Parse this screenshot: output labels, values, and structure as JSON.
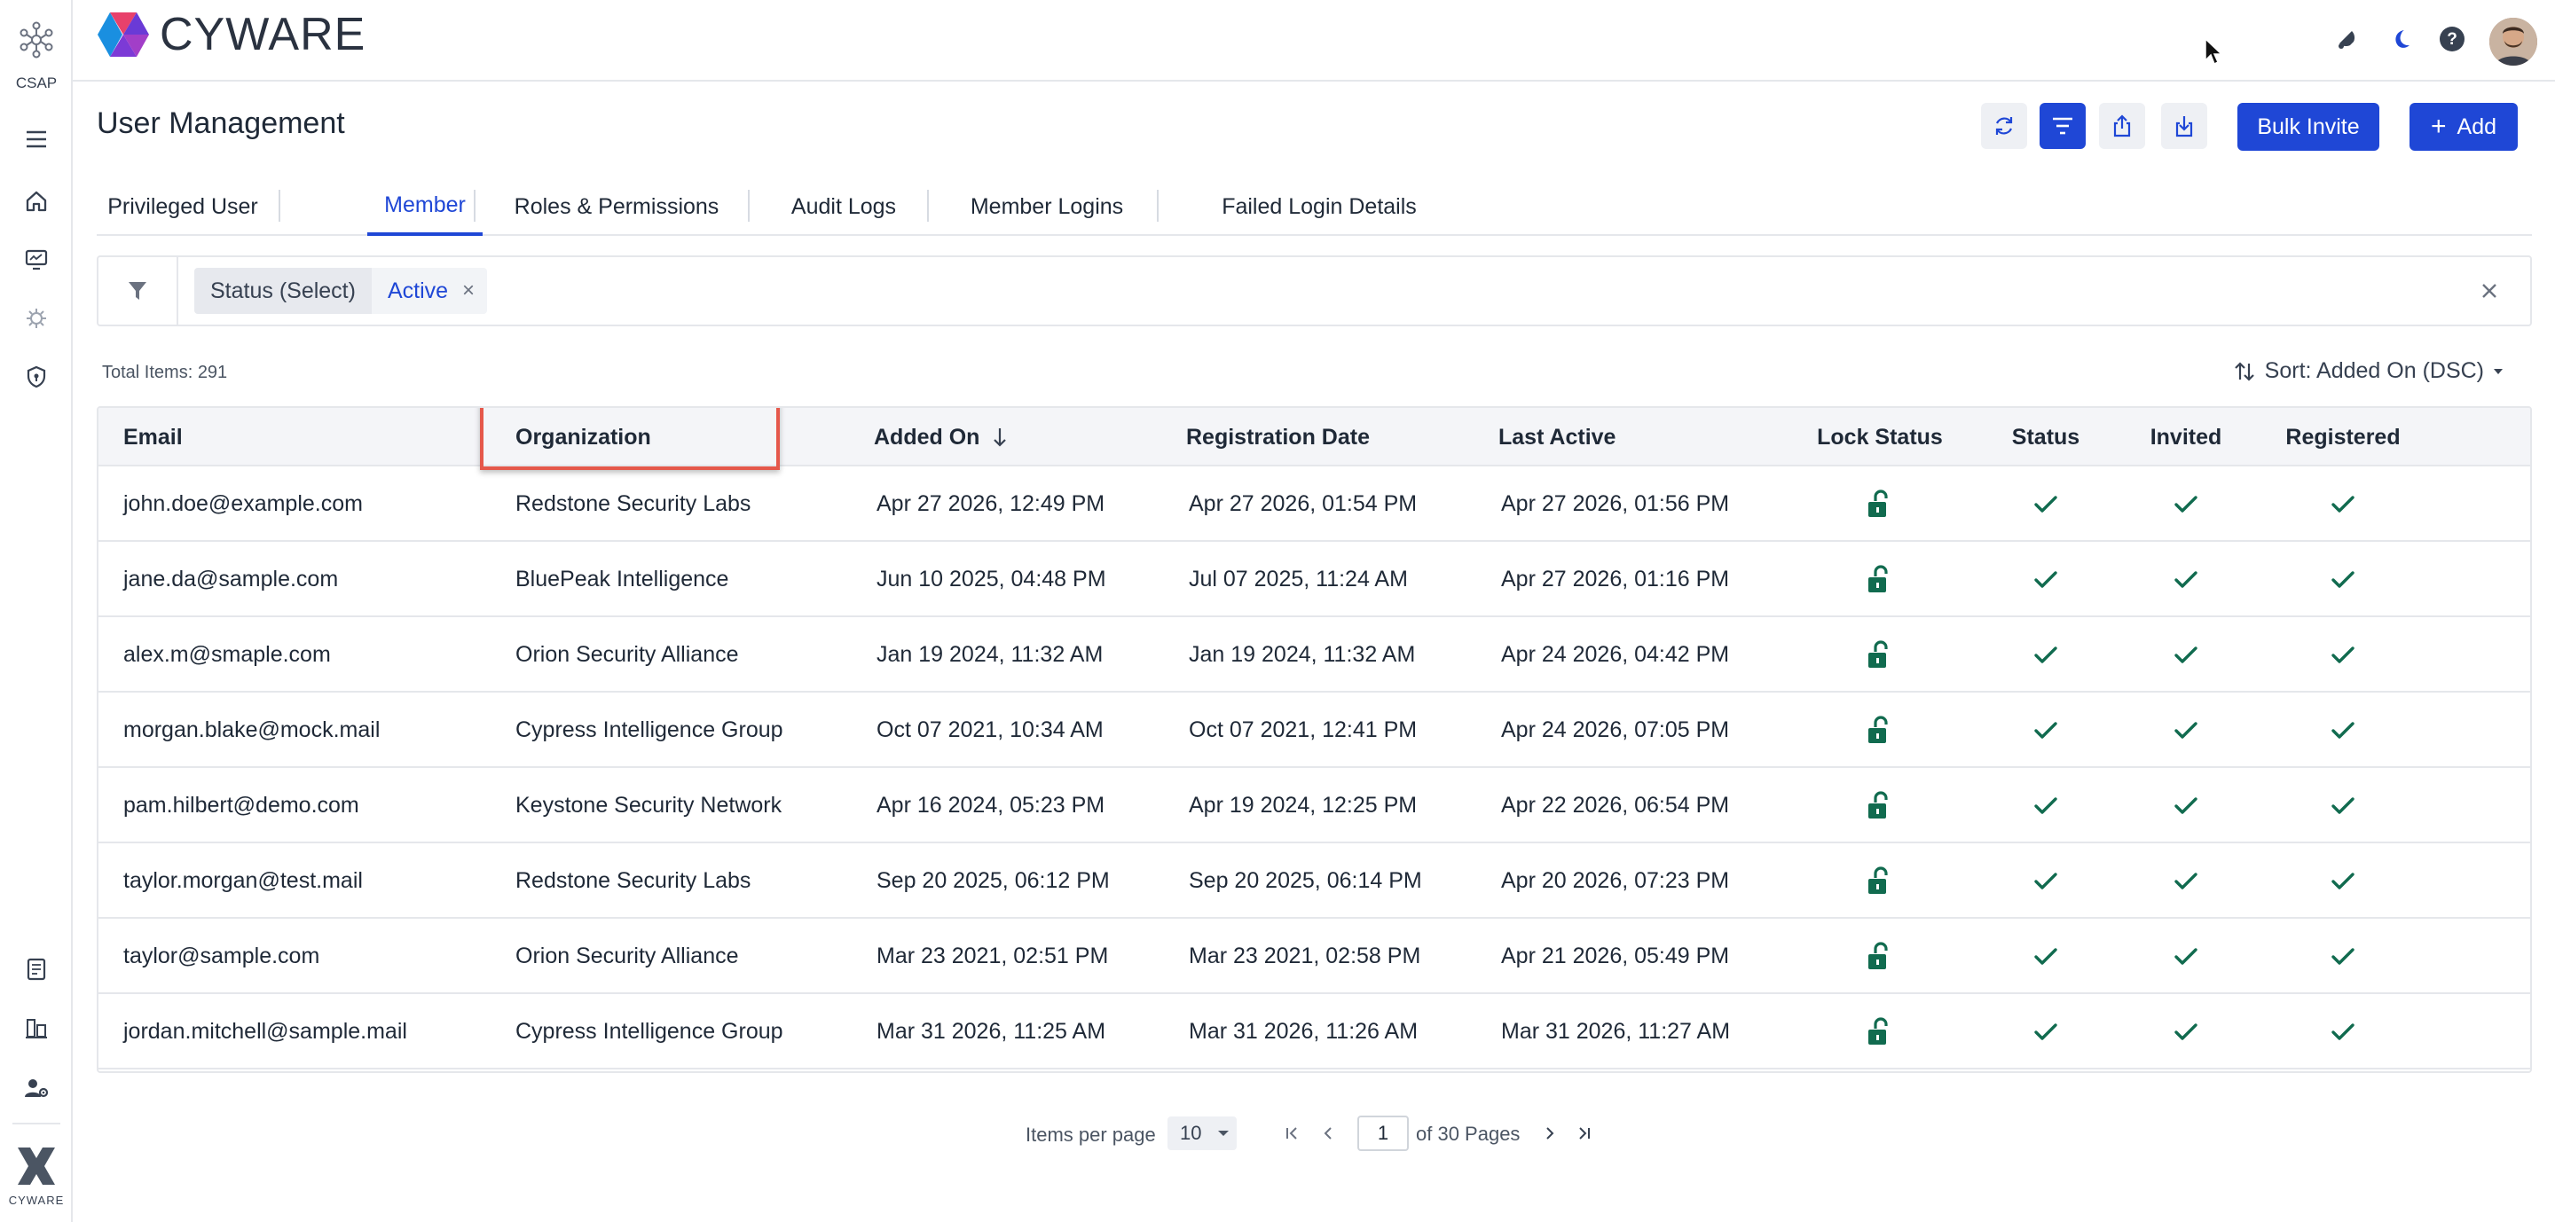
{
  "app": {
    "rail_label": "CSAP",
    "brand_name": "CYWARE",
    "brand_small": "CYWARE"
  },
  "page": {
    "title": "User Management"
  },
  "actions": {
    "bulk_invite": "Bulk Invite",
    "add": "Add",
    "add_icon": "+"
  },
  "tabs": [
    {
      "label": "Privileged User"
    },
    {
      "label": "Member"
    },
    {
      "label": "Roles & Permissions"
    },
    {
      "label": "Audit Logs"
    },
    {
      "label": "Member Logins"
    },
    {
      "label": "Failed Login Details"
    }
  ],
  "active_tab": "Member",
  "filter": {
    "key": "Status (Select)",
    "value": "Active",
    "remove_glyph": "×"
  },
  "list": {
    "total": "Total Items: 291",
    "sort": "Sort: Added On (DSC)"
  },
  "table": {
    "columns": [
      "Email",
      "Organization",
      "Added On",
      "Registration Date",
      "Last Active",
      "Lock Status",
      "Status",
      "Invited",
      "Registered"
    ],
    "rows": [
      {
        "email": "john.doe@example.com",
        "org": "Redstone Security Labs",
        "added": "Apr 27 2026, 12:49 PM",
        "registered_on": "Apr 27 2026, 01:54 PM",
        "last_active": "Apr 27 2026, 01:56 PM"
      },
      {
        "email": "jane.da@sample.com",
        "org": "BluePeak Intelligence",
        "added": "Jun 10 2025, 04:48 PM",
        "registered_on": "Jul 07 2025, 11:24 AM",
        "last_active": "Apr 27 2026, 01:16 PM"
      },
      {
        "email": "alex.m@smaple.com",
        "org": "Orion Security Alliance",
        "added": "Jan 19 2024, 11:32 AM",
        "registered_on": "Jan 19 2024, 11:32 AM",
        "last_active": "Apr 24 2026, 04:42 PM"
      },
      {
        "email": "morgan.blake@mock.mail",
        "org": "Cypress Intelligence Group",
        "added": "Oct 07 2021, 10:34 AM",
        "registered_on": "Oct 07 2021, 12:41 PM",
        "last_active": "Apr 24 2026, 07:05 PM"
      },
      {
        "email": "pam.hilbert@demo.com",
        "org": "Keystone Security Network",
        "added": "Apr 16 2024, 05:23 PM",
        "registered_on": "Apr 19 2024, 12:25 PM",
        "last_active": "Apr 22 2026, 06:54 PM"
      },
      {
        "email": "taylor.morgan@test.mail",
        "org": "Redstone Security Labs",
        "added": "Sep 20 2025, 06:12 PM",
        "registered_on": "Sep 20 2025, 06:14 PM",
        "last_active": "Apr 20 2026, 07:23 PM"
      },
      {
        "email": "taylor@sample.com",
        "org": "Orion Security Alliance",
        "added": "Mar 23 2021, 02:51 PM",
        "registered_on": "Mar 23 2021, 02:58 PM",
        "last_active": "Apr 21 2026, 05:49 PM"
      },
      {
        "email": "jordan.mitchell@sample.mail",
        "org": "Cypress Intelligence Group",
        "added": "Mar 31 2026, 11:25 AM",
        "registered_on": "Mar 31 2026, 11:26 AM",
        "last_active": "Mar 31 2026, 11:27 AM"
      }
    ]
  },
  "pagination": {
    "items_per_page_label": "Items per page",
    "items_per_page": "10",
    "current_page": "1",
    "of_pages": "of 30 Pages"
  },
  "colors": {
    "primary": "#1f47d6",
    "check": "#116b4f",
    "highlight": "#e5584b"
  }
}
